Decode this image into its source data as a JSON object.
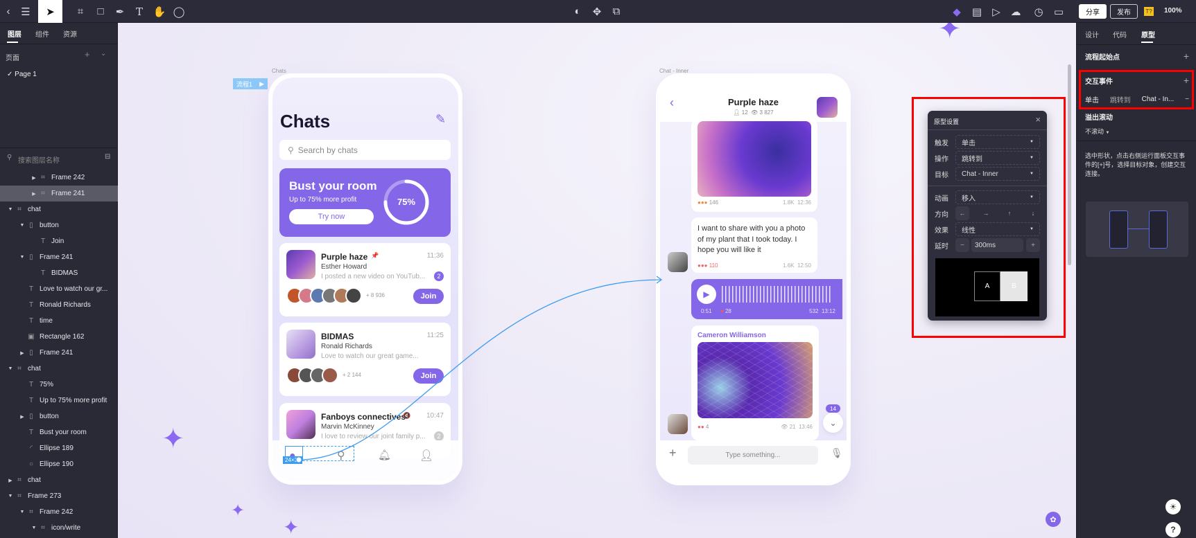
{
  "toolbar": {
    "tools": [
      "back-icon",
      "menu-icon",
      "select-icon",
      "frame-icon",
      "rectangle-icon",
      "pen-icon",
      "text-icon",
      "hand-icon",
      "comment-icon"
    ],
    "center_icons": [
      "contrast-icon",
      "move-icon",
      "boolean-icon"
    ],
    "share": "分享",
    "publish": "发布",
    "plugin_badge": "T?",
    "zoom": "100%"
  },
  "left_panel": {
    "tabs": [
      "图层",
      "组件",
      "资源"
    ],
    "pages_label": "页面",
    "pages": [
      "Page 1"
    ],
    "search_placeholder": "搜索图层名称",
    "layers": [
      {
        "label": "Frame 242",
        "level": 3,
        "type": "frame",
        "arrow": "right"
      },
      {
        "label": "Frame 241",
        "level": 3,
        "type": "frame",
        "arrow": "right",
        "selected": true
      },
      {
        "label": "chat",
        "level": 1,
        "type": "frame",
        "arrow": "down"
      },
      {
        "label": "button",
        "level": 2,
        "type": "group",
        "arrow": "down"
      },
      {
        "label": "Join",
        "level": 3,
        "type": "text"
      },
      {
        "label": "Frame 241",
        "level": 2,
        "type": "group",
        "arrow": "down"
      },
      {
        "label": "BIDMAS",
        "level": 3,
        "type": "text"
      },
      {
        "label": "Love to watch our gr...",
        "level": 2,
        "type": "text"
      },
      {
        "label": "Ronald Richards",
        "level": 2,
        "type": "text"
      },
      {
        "label": "time",
        "level": 2,
        "type": "text"
      },
      {
        "label": "Rectangle 162",
        "level": 2,
        "type": "image"
      },
      {
        "label": "Frame 241",
        "level": 2,
        "type": "group",
        "arrow": "right"
      },
      {
        "label": "chat",
        "level": 1,
        "type": "frame",
        "arrow": "down"
      },
      {
        "label": "75%",
        "level": 2,
        "type": "text"
      },
      {
        "label": "Up to 75% more profit",
        "level": 2,
        "type": "text"
      },
      {
        "label": "button",
        "level": 2,
        "type": "group",
        "arrow": "right"
      },
      {
        "label": "Bust your room",
        "level": 2,
        "type": "text"
      },
      {
        "label": "Ellipse 189",
        "level": 2,
        "type": "arc"
      },
      {
        "label": "Ellipse 190",
        "level": 2,
        "type": "ellipse"
      },
      {
        "label": "chat",
        "level": 1,
        "type": "frame",
        "arrow": "right"
      },
      {
        "label": "Frame 273",
        "level": 1,
        "type": "frame",
        "arrow": "down"
      },
      {
        "label": "Frame 242",
        "level": 2,
        "type": "frame",
        "arrow": "down"
      },
      {
        "label": "icon/write",
        "level": 3,
        "type": "frame",
        "arrow": "down"
      }
    ]
  },
  "canvas": {
    "flow_label": "流程1",
    "selection_size": "24×32",
    "chats": {
      "frame_label": "Chats",
      "title": "Chats",
      "search_placeholder": "Search by chats",
      "promo": {
        "title": "Bust your room",
        "subtitle": "Up to 75% more profit",
        "button": "Try now",
        "progress_label": "75%",
        "progress": 0.75
      },
      "items": [
        {
          "name": "Purple haze",
          "sender": "Esther Howard",
          "message": "I posted a new video on YouTub...",
          "time": "11:36",
          "unread": "2",
          "members": "+ 8 936",
          "join": "Join",
          "pinned": true
        },
        {
          "name": "BIDMAS",
          "sender": "Ronald Richards",
          "message": "Love to watch our great game...",
          "time": "11:25",
          "members": "+ 2 144",
          "join": "Join"
        },
        {
          "name": "Fanboys connectives",
          "sender": "Marvin McKinney",
          "message": "I love to review our joint family p...",
          "time": "10:47",
          "unread": "2",
          "muted": true
        }
      ]
    },
    "inner": {
      "frame_label": "Chat - Inner",
      "title": "Purple haze",
      "members": "12",
      "views": "3 827",
      "msg1": {
        "reactions": "146",
        "views": "1.8K",
        "time": "12:36"
      },
      "msg2": {
        "text": "I want to share with you a photo of my plant that I took today. I hope you will like it",
        "reactions": "110",
        "views": "1.6K",
        "time": "12:50"
      },
      "voice": {
        "duration": "0:51",
        "likes": "28",
        "views": "532",
        "time": "13:12"
      },
      "msg3": {
        "author": "Cameron Williamson",
        "reactions": "4",
        "views": "21",
        "time": "13:46"
      },
      "new_count": "14",
      "input_placeholder": "Type something..."
    },
    "dialog": {
      "title": "原型设置",
      "rows": [
        {
          "label": "触发",
          "value": "单击"
        },
        {
          "label": "操作",
          "value": "跳转到"
        },
        {
          "label": "目标",
          "value": "Chat - Inner"
        }
      ],
      "animation": {
        "label": "动画",
        "value": "移入"
      },
      "direction": {
        "label": "方向",
        "options": [
          "←",
          "→",
          "↑",
          "↓"
        ],
        "selected": "←"
      },
      "effect": {
        "label": "效果",
        "value": "线性"
      },
      "delay": {
        "label": "延时",
        "value": "300ms",
        "minus": "−",
        "plus": "+"
      },
      "preview": {
        "a": "A",
        "b": "B"
      }
    }
  },
  "right_panel": {
    "tabs": [
      "设计",
      "代码",
      "原型"
    ],
    "active_tab": "原型",
    "flow_start": "流程起始点",
    "interactions": "交互事件",
    "interaction": {
      "trigger": "单击",
      "action": "跳转到",
      "target": "Chat - In..."
    },
    "overflow_label": "溢出滚动",
    "overflow_value": "不滚动",
    "hint": "选中形状，点击右侧运行面板交互事件的[+]号，选择目标对象，创建交互连接。"
  },
  "colors": {
    "accent": "#8466e8",
    "highlight": "#ff0000",
    "flow_line": "#3d9cf0"
  }
}
